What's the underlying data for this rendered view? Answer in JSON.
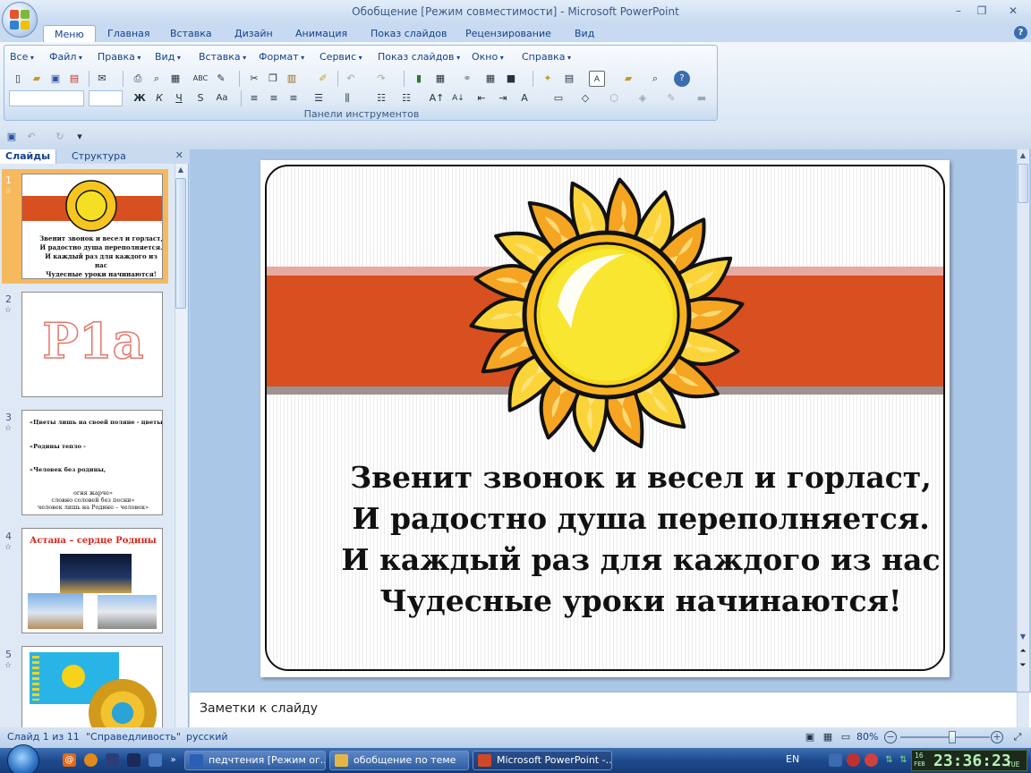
{
  "window": {
    "title": "Обобщение [Режим совместимости] - Microsoft PowerPoint"
  },
  "tabs": [
    "Меню",
    "Главная",
    "Вставка",
    "Дизайн",
    "Анимация",
    "Показ слайдов",
    "Рецензирование",
    "Вид"
  ],
  "active_tab": "Меню",
  "menu_items": [
    "Все",
    "Файл",
    "Правка",
    "Вид",
    "Вставка",
    "Формат",
    "Сервис",
    "Показ слайдов",
    "Окно",
    "Справка"
  ],
  "ribbon_group_label": "Панели инструментов",
  "panel_tabs": {
    "slides": "Слайды",
    "outline": "Структура"
  },
  "thumbnails": [
    {
      "num": "1",
      "lines": [
        "Звенит звонок и весел и горласт,",
        "И радостно душа переполняется.",
        "И каждый раз для каждого из нас",
        "Чудесные уроки начинаются!"
      ]
    },
    {
      "num": "2",
      "text": "P1a"
    },
    {
      "num": "3",
      "lines": [
        "«Цветы лишь на своей поляне - цветы",
        "«Родины тепло -",
        "«Человек без родины,",
        "огня жарче»",
        "словно соловей без песни»",
        "человек лишь на Родине – человек»"
      ]
    },
    {
      "num": "4",
      "title": "Астана – сердце Родины"
    },
    {
      "num": "5"
    }
  ],
  "slide": {
    "poem": [
      "Звенит звонок и весел и горласт,",
      "И радостно душа переполняется.",
      "И каждый раз для каждого из нас",
      "Чудесные уроки начинаются!"
    ]
  },
  "notes": {
    "placeholder": "Заметки к слайду"
  },
  "status": {
    "slide": "Слайд 1 из 11",
    "theme": "\"Справедливость\"",
    "language": "русский",
    "zoom": "80%",
    "zoom_fraction": 0.58
  },
  "taskbar": {
    "buttons": [
      "педчтения [Режим ог...",
      "обобщение по теме",
      "Microsoft PowerPoint -..."
    ],
    "lang": "EN",
    "date_day": "16",
    "date_month": "FEB",
    "time": "23:36:23",
    "weekday": "TUE"
  },
  "colors": {
    "accent_band": "#d84f20",
    "sun": "#f5c400",
    "ribbon": "#dbe7f5"
  }
}
